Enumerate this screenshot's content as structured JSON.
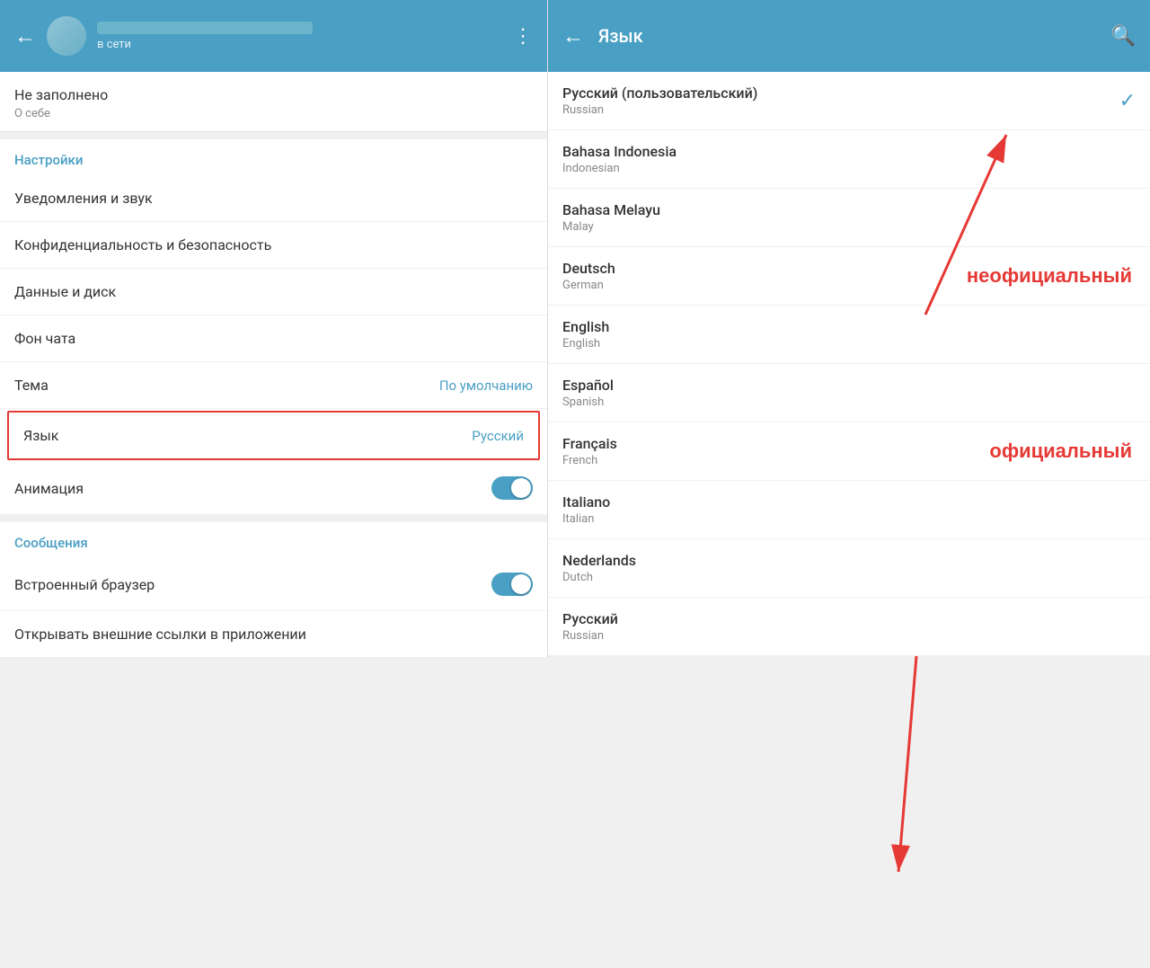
{
  "left": {
    "header": {
      "back_label": "←",
      "status": "в сети",
      "menu_icon": "⋮"
    },
    "not_filled": {
      "title": "Не заполнено",
      "subtitle": "О себе"
    },
    "settings_section": "Настройки",
    "items": [
      {
        "label": "Уведомления и звук",
        "value": ""
      },
      {
        "label": "Конфиденциальность и безопасность",
        "value": ""
      },
      {
        "label": "Данные и диск",
        "value": ""
      },
      {
        "label": "Фон чата",
        "value": ""
      },
      {
        "label": "Тема",
        "value": "По умолчанию"
      },
      {
        "label": "Язык",
        "value": "Русский",
        "highlighted": true
      },
      {
        "label": "Анимация",
        "value": "toggle"
      }
    ],
    "messages_section": "Сообщения",
    "messages_items": [
      {
        "label": "Встроенный браузер",
        "value": "toggle"
      },
      {
        "label": "Открывать внешние ссылки в приложении",
        "value": ""
      }
    ]
  },
  "right": {
    "header": {
      "back_label": "←",
      "title": "Язык",
      "search_icon": "🔍"
    },
    "languages": [
      {
        "name": "Русский (пользовательский)",
        "native": "Russian",
        "selected": true,
        "annotation": ""
      },
      {
        "name": "Bahasa Indonesia",
        "native": "Indonesian",
        "selected": false,
        "annotation": ""
      },
      {
        "name": "Bahasa Melayu",
        "native": "Malay",
        "selected": false,
        "annotation": ""
      },
      {
        "name": "Deutsch",
        "native": "German",
        "selected": false,
        "annotation": "неофициальный"
      },
      {
        "name": "English",
        "native": "English",
        "selected": false,
        "annotation": ""
      },
      {
        "name": "Español",
        "native": "Spanish",
        "selected": false,
        "annotation": ""
      },
      {
        "name": "Français",
        "native": "French",
        "selected": false,
        "annotation": "официальный"
      },
      {
        "name": "Italiano",
        "native": "Italian",
        "selected": false,
        "annotation": ""
      },
      {
        "name": "Nederlands",
        "native": "Dutch",
        "selected": false,
        "annotation": ""
      },
      {
        "name": "Русский",
        "native": "Russian",
        "selected": false,
        "annotation": ""
      }
    ]
  }
}
